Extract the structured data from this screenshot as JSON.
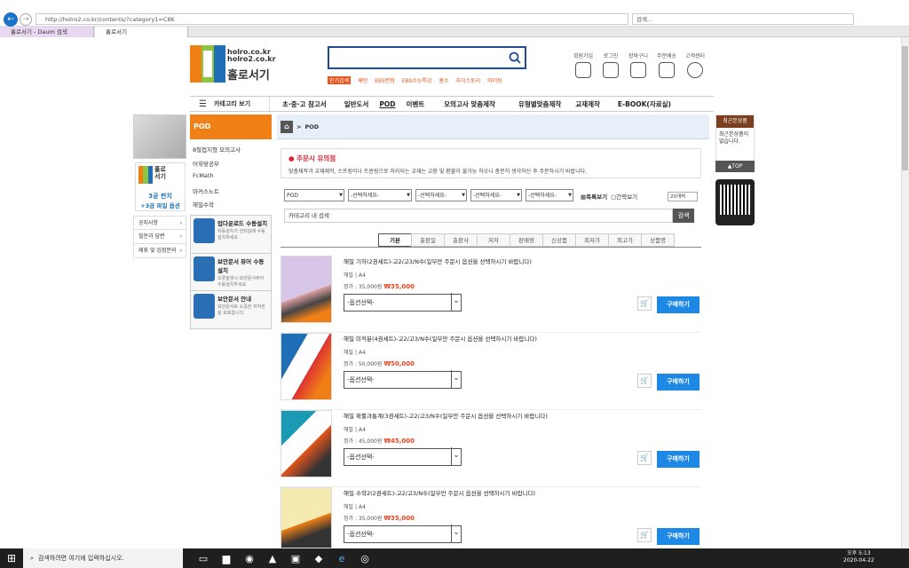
{
  "browser": {
    "url": "http://holro2.co.kr/contents/?category1=C8K",
    "search_placeholder": "검색...",
    "tabs": [
      {
        "label": "홀로서기 - Daum 검색"
      },
      {
        "label": "홀로서기"
      }
    ]
  },
  "site": {
    "logo_line1": "holro.co.kr",
    "logo_line2": "holro2.co.kr",
    "logo_name": "홀로서기",
    "popular_label": "인기검색",
    "popular": [
      "패턴",
      "EBS변형",
      "EBS수능특강",
      "홍수",
      "자이스토리",
      "마더텅"
    ],
    "top_icons": [
      {
        "label": "회원가입",
        "icon": "user-plus-icon"
      },
      {
        "label": "로그인",
        "icon": "monitor-icon"
      },
      {
        "label": "장바구니",
        "icon": "cart-icon"
      },
      {
        "label": "주문배송",
        "icon": "delivery-icon"
      },
      {
        "label": "고객센터",
        "icon": "qa-icon"
      }
    ]
  },
  "menu": {
    "category_label": "카테고리 보기",
    "items": [
      "초·중·고 참고서",
      "일반도서",
      "POD",
      "이벤트",
      "모의고사 맞춤제작",
      "유형별맞춤제작",
      "교재제작",
      "E-BOOK(자료실)"
    ]
  },
  "left": {
    "banner2_text1": "홀로",
    "banner2_text2": "서기",
    "banner2_sub1": "3공 펀치",
    "banner2_sub2": "+3공 파일 옵션",
    "links": [
      "공지사항",
      "질문과 답변",
      "제휴 및 입점문의"
    ]
  },
  "sidebar": {
    "header": "POD",
    "items": [
      "8절접지형 모의고사",
      "어휘맞공부",
      "FcMath",
      "마커스노트",
      "해밀수학"
    ],
    "services": [
      {
        "title": "업다운로드 수동설치",
        "desc": "자동설치가 안되실때 수동설치하세요"
      },
      {
        "title": "보안문서 뷰어 수동설치",
        "desc": "오류발생시 보안문서뷰어 수동설치하세요"
      },
      {
        "title": "보안문서 안내",
        "desc": "보안문서로 소중한 저작권을 보호합니다."
      }
    ]
  },
  "content": {
    "breadcrumb": "POD",
    "notice_title": "주문시 유의점",
    "notice_body": "맞춤제작과 교재제작, 스프링이나 트윈링으로 처리되는 교재는 교환 및 환불이 불가능 하오니 충분히 생각하신 후 주문하시기 바랍니다.",
    "filters": [
      "POD",
      "-선택하세요-",
      "-선택하세요-",
      "-선택하세요-",
      "-선택하세요-"
    ],
    "view_list": "목록보기",
    "view_simple": "간략보기",
    "count": "20개씩",
    "cat_search_placeholder": "카테고리 내 검색",
    "cat_search_btn": "검색",
    "sort_tabs": [
      "기본",
      "출판일",
      "출판사",
      "저자",
      "판매량",
      "신상품",
      "최저가",
      "최고가",
      "상품명"
    ],
    "products": [
      {
        "name": "해밀 기하(2권세트)-고2/고3/N수(일부만 주문시 옵션을 선택하시기 바랍니다)",
        "meta": "해밀 | A4",
        "list_price": "정가 : 35,000원",
        "price": "₩35,000",
        "option": "-옵션선택-",
        "buy": "구매하기"
      },
      {
        "name": "해밀 미적분(4권세트)-고2/고3/N수(일부만 주문시 옵션을 선택하시기 바랍니다)",
        "meta": "해밀 | A4",
        "list_price": "정가 : 50,000원",
        "price": "₩50,000",
        "option": "-옵션선택-",
        "buy": "구매하기"
      },
      {
        "name": "해밀 확률과통계(3권세트)-고2/고3/N수(일부만 주문시 옵션을 선택하시기 바랍니다)",
        "meta": "해밀 | A4",
        "list_price": "정가 : 45,000원",
        "price": "₩45,000",
        "option": "-옵션선택-",
        "buy": "구매하기"
      },
      {
        "name": "해밀 수학2(2권세트)-고2/고3/N수(일부만 주문시 옵션을 선택하시기 바랍니다)",
        "meta": "해밀 | A4",
        "list_price": "정가 : 35,000원",
        "price": "₩35,000",
        "option": "-옵션선택-",
        "buy": "구매하기"
      }
    ]
  },
  "right": {
    "recent_title": "최근본상품",
    "recent_body": "최근본상품이 없습니다.",
    "top": "▲TOP"
  },
  "taskbar": {
    "search_placeholder": "검색하려면 여기에 입력하십시오.",
    "time": "오후 5:13",
    "date": "2020-04-22"
  },
  "colors": {
    "accent": "#f07f15",
    "brand_blue": "#1e4c8c",
    "buy": "#1e88e5",
    "price": "#ee4422"
  }
}
